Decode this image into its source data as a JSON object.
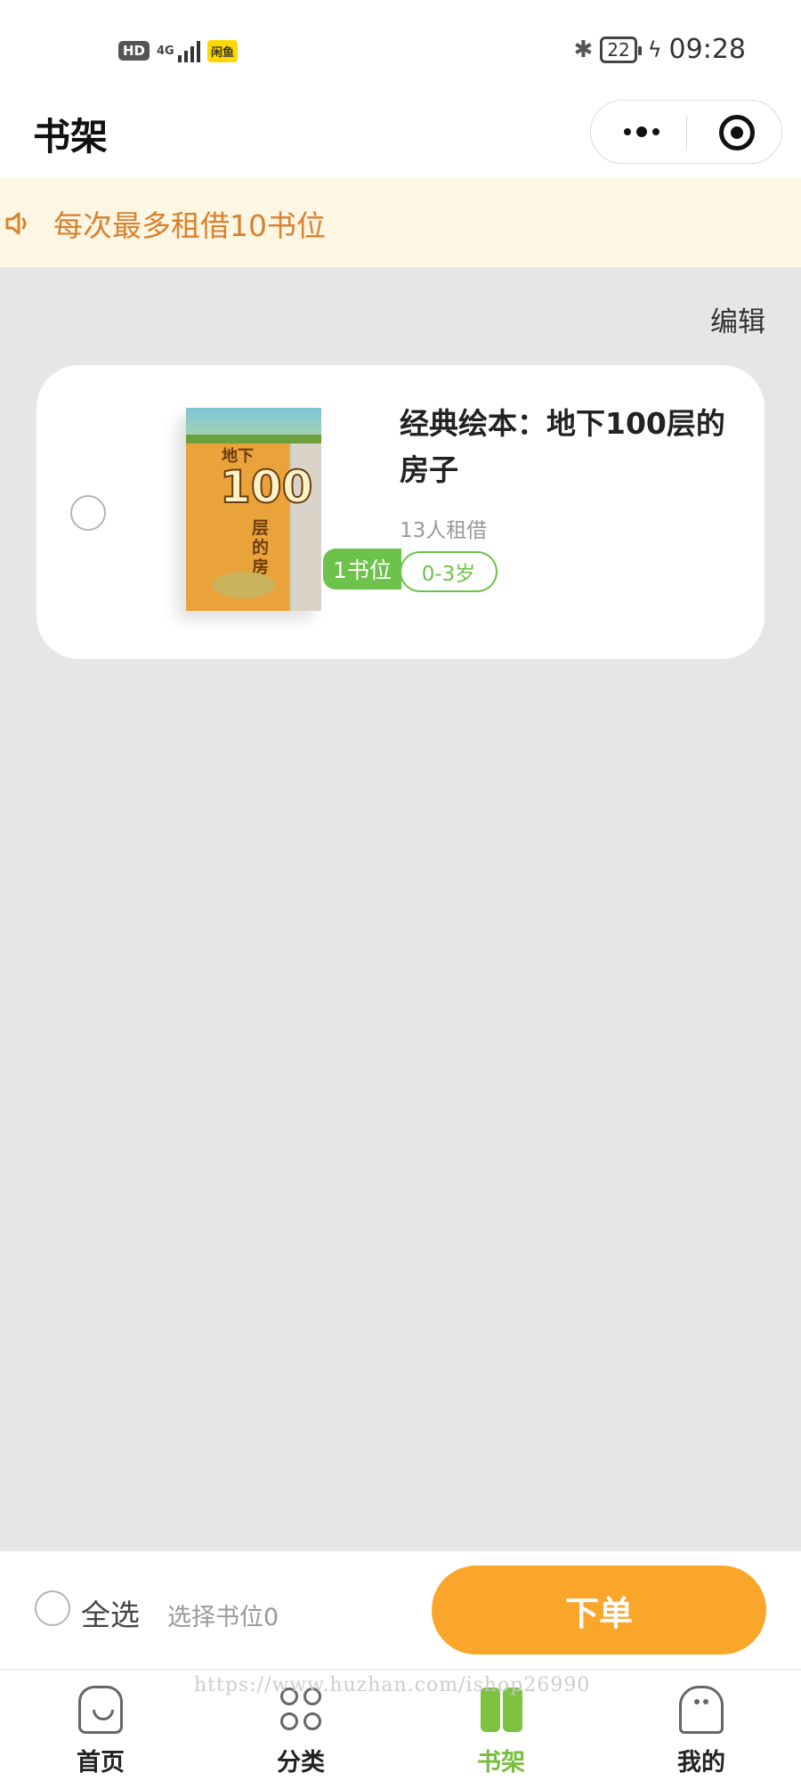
{
  "status_bar": {
    "hd": "HD",
    "network": "4G",
    "app_badge": "闲鱼",
    "battery": "22",
    "time": "09:28"
  },
  "header": {
    "title": "书架"
  },
  "notice": {
    "text": "每次最多租借10书位"
  },
  "toolbar": {
    "edit_label": "编辑"
  },
  "book": {
    "title": "经典绘本：地下100层的房子",
    "borrow_count": "13人租借",
    "age_tag": "0-3岁",
    "slot_badge": "1书位",
    "selected": false,
    "cover": {
      "top_text": "地下",
      "number": "100",
      "subtitle": "层的房子"
    }
  },
  "bottom_bar": {
    "select_all_label": "全选",
    "selected_info": "选择书位0",
    "order_label": "下单"
  },
  "tabs": [
    {
      "label": "首页",
      "icon": "home-icon",
      "active": false
    },
    {
      "label": "分类",
      "icon": "category-icon",
      "active": false
    },
    {
      "label": "书架",
      "icon": "bookshelf-icon",
      "active": true
    },
    {
      "label": "我的",
      "icon": "profile-icon",
      "active": false
    }
  ],
  "watermark": "https://www.huzhan.com/ishop26990",
  "colors": {
    "accent_orange": "#f9a62b",
    "notice_bg": "#fdf6e2",
    "notice_text": "#d8812e",
    "accent_green": "#6cc24a",
    "page_bg": "#e6e6e6"
  }
}
